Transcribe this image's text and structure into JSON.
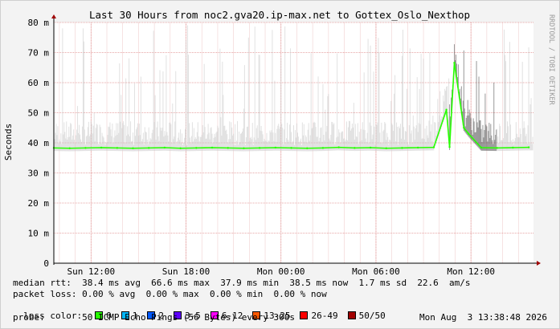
{
  "chart_data": {
    "type": "line",
    "title": "Last 30 Hours from noc2.gva20.ip-max.net to Gottex_Oslo_Nexthop",
    "ylabel": "Seconds",
    "xlabel": "",
    "side_label": "RRDTOOL / TOBI OETIKER",
    "y_ticks": [
      "0",
      "10 m",
      "20 m",
      "30 m",
      "40 m",
      "50 m",
      "60 m",
      "70 m",
      "80 m"
    ],
    "ylim": [
      0,
      80
    ],
    "x_ticks": [
      "Sun 12:00",
      "Sun 18:00",
      "Mon 00:00",
      "Mon 06:00",
      "Mon 12:00"
    ],
    "grid": true,
    "series": [
      {
        "name": "median rtt",
        "unit": "ms",
        "x_hours": [
          0,
          1,
          2,
          3,
          4,
          5,
          6,
          7,
          8,
          9,
          10,
          11,
          12,
          13,
          14,
          15,
          16,
          17,
          18,
          19,
          20,
          21,
          22,
          23,
          24,
          24.8,
          25,
          25.3,
          25.9,
          26.2,
          27,
          28,
          29,
          30
        ],
        "values": [
          38.3,
          38.2,
          38.3,
          38.4,
          38.3,
          38.2,
          38.3,
          38.4,
          38.2,
          38.3,
          38.4,
          38.3,
          38.2,
          38.3,
          38.4,
          38.3,
          38.2,
          38.3,
          38.5,
          38.3,
          38.4,
          38.2,
          38.3,
          38.4,
          38.5,
          51.0,
          38.6,
          66.6,
          45.0,
          43.0,
          38.4,
          38.3,
          38.4,
          38.5
        ]
      }
    ],
    "stats": {
      "median_rtt": "median rtt:  38.4 ms avg  66.6 ms max  37.9 ms min  38.5 ms now  1.7 ms sd  22.6  am/s",
      "packet_loss": "packet loss: 0.00 % avg  0.00 % max  0.00 % min  0.00 % now",
      "loss_color_label": "loss color:",
      "probe": "probe:       50 ICMP Echo Pings (56 Bytes) every 300s",
      "timestamp": "Mon Aug  3 13:38:48 2026"
    },
    "loss_colors": [
      {
        "label": "0",
        "color": "#26ff00"
      },
      {
        "label": "1",
        "color": "#00b8ff"
      },
      {
        "label": "2",
        "color": "#0059ff"
      },
      {
        "label": "3-5",
        "color": "#5e00ff"
      },
      {
        "label": "6-12",
        "color": "#ff00ff"
      },
      {
        "label": "13-25",
        "color": "#ff5900"
      },
      {
        "label": "26-49",
        "color": "#ff0000"
      },
      {
        "label": "50/50",
        "color": "#a10000"
      }
    ]
  }
}
